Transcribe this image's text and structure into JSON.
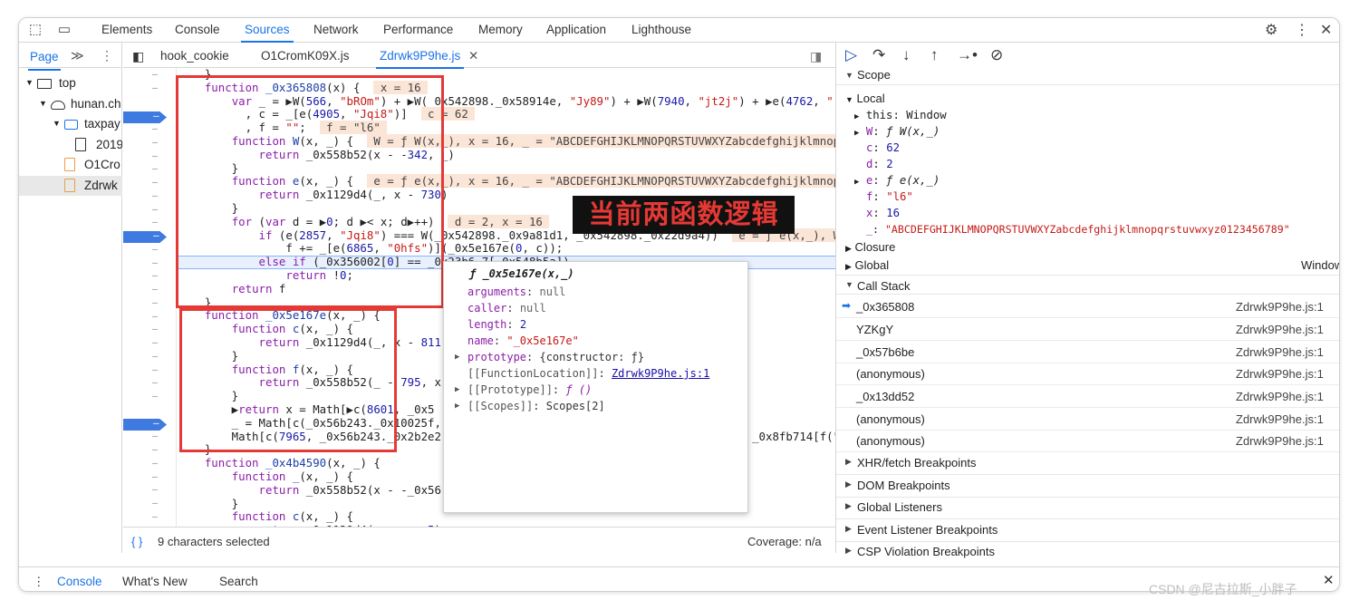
{
  "topbar": {
    "tabs": [
      "Elements",
      "Console",
      "Sources",
      "Network",
      "Performance",
      "Memory",
      "Application",
      "Lighthouse"
    ],
    "active_tab": "Sources"
  },
  "navigator": {
    "tab_label": "Page",
    "tree": [
      {
        "label": "top",
        "icon": "window-icon"
      },
      {
        "label": "hunan.ch",
        "icon": "cloud-icon"
      },
      {
        "label": "taxpay",
        "icon": "folder-icon"
      },
      {
        "label": "2019",
        "icon": "file-icon"
      },
      {
        "label": "O1Cro",
        "icon": "file-icon"
      },
      {
        "label": "Zdrwk",
        "icon": "file-icon"
      }
    ]
  },
  "editor": {
    "tabs": [
      "hook_cookie",
      "O1CromK09X.js",
      "Zdrwk9P9he.js"
    ],
    "active_tab": "Zdrwk9P9he.js",
    "status_left": "9 characters selected",
    "status_right": "Coverage: n/a"
  },
  "annotation": {
    "text": "当前两函数逻辑"
  },
  "popup": {
    "title": "ƒ _0x5e167e(x,_)",
    "rows": [
      {
        "key": "arguments",
        "value": "null"
      },
      {
        "key": "caller",
        "value": "null"
      },
      {
        "key": "length",
        "value": "2"
      },
      {
        "key": "name",
        "value": "\"_0x5e167e\""
      },
      {
        "key": "prototype",
        "value": "{constructor: ƒ}"
      },
      {
        "key": "[[FunctionLocation]]",
        "value": "Zdrwk9P9he.js:1"
      },
      {
        "key": "[[Prototype]]",
        "value": "ƒ ()"
      },
      {
        "key": "[[Scopes]]",
        "value": "Scopes[2]"
      }
    ]
  },
  "scope": {
    "header": "Scope",
    "local_header": "Local",
    "local": [
      {
        "key": "this",
        "value": "Window"
      },
      {
        "key": "W",
        "value": "ƒ W(x,_)"
      },
      {
        "key": "c",
        "value": "62"
      },
      {
        "key": "d",
        "value": "2"
      },
      {
        "key": "e",
        "value": "ƒ e(x,_)"
      },
      {
        "key": "f",
        "value": "\"l6\""
      },
      {
        "key": "x",
        "value": "16"
      },
      {
        "key": "_",
        "value": "\"ABCDEFGHIJKLMNOPQRSTUVWXYZabcdefghijklmnopqrstuvwxyz0123456789\""
      }
    ],
    "closure": "Closure",
    "global": "Global",
    "global_value": "Window"
  },
  "call_stack": {
    "header": "Call Stack",
    "frames": [
      {
        "name": "_0x365808",
        "loc": "Zdrwk9P9he.js:1"
      },
      {
        "name": "YZKgY",
        "loc": "Zdrwk9P9he.js:1"
      },
      {
        "name": "_0x57b6be",
        "loc": "Zdrwk9P9he.js:1"
      },
      {
        "name": "(anonymous)",
        "loc": "Zdrwk9P9he.js:1"
      },
      {
        "name": "_0x13dd52",
        "loc": "Zdrwk9P9he.js:1"
      },
      {
        "name": "(anonymous)",
        "loc": "Zdrwk9P9he.js:1"
      },
      {
        "name": "(anonymous)",
        "loc": "Zdrwk9P9he.js:1"
      }
    ]
  },
  "breakpoint_sections": [
    "XHR/fetch Breakpoints",
    "DOM Breakpoints",
    "Global Listeners",
    "Event Listener Breakpoints",
    "CSP Violation Breakpoints"
  ],
  "drawer": {
    "tabs": [
      "Console",
      "What's New",
      "Search"
    ],
    "active": "Console"
  },
  "watermark": "CSDN @尼古拉斯_小胖子"
}
